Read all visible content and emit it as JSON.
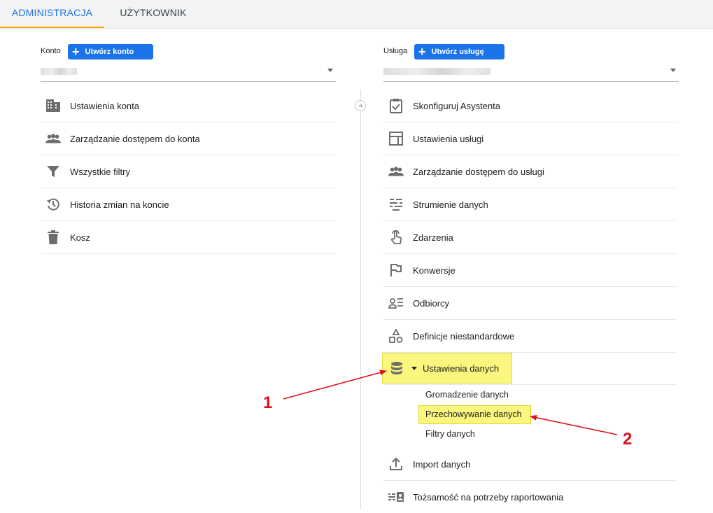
{
  "tabs": [
    {
      "label": "ADMINISTRACJA",
      "active": true
    },
    {
      "label": "UŻYTKOWNIK",
      "active": false
    }
  ],
  "account": {
    "header_label": "Konto",
    "create_button": "Utwórz konto"
  },
  "property": {
    "header_label": "Usługa",
    "create_button": "Utwórz usługę"
  },
  "account_items": [
    {
      "label": "Ustawienia konta",
      "icon": "building-icon"
    },
    {
      "label": "Zarządzanie dostępem do konta",
      "icon": "people-icon"
    },
    {
      "label": "Wszystkie filtry",
      "icon": "filter-icon"
    },
    {
      "label": "Historia zmian na koncie",
      "icon": "history-icon"
    },
    {
      "label": "Kosz",
      "icon": "trash-icon"
    }
  ],
  "property_items": [
    {
      "label": "Skonfiguruj Asystenta",
      "icon": "clipboard-check-icon"
    },
    {
      "label": "Ustawienia usługi",
      "icon": "layout-icon"
    },
    {
      "label": "Zarządzanie dostępem do usługi",
      "icon": "people-icon"
    },
    {
      "label": "Strumienie danych",
      "icon": "streams-icon"
    },
    {
      "label": "Zdarzenia",
      "icon": "touch-icon"
    },
    {
      "label": "Konwersje",
      "icon": "flag-icon"
    },
    {
      "label": "Odbiorcy",
      "icon": "audience-icon"
    },
    {
      "label": "Definicje niestandardowe",
      "icon": "shapes-icon"
    }
  ],
  "data_settings": {
    "label": "Ustawienia danych",
    "icon": "database-icon",
    "sub_items": [
      "Gromadzenie danych",
      "Przechowywanie danych",
      "Filtry danych"
    ]
  },
  "property_items_after": [
    {
      "label": "Import danych",
      "icon": "upload-icon"
    },
    {
      "label": "Tożsamość na potrzeby raportowania",
      "icon": "identity-icon"
    }
  ],
  "annotations": [
    "1",
    "2"
  ],
  "colors": {
    "accent": "#1a73e8",
    "tab_indicator": "#f9ab00",
    "highlight": "#fbf67d",
    "annotation": "#e0101a"
  }
}
